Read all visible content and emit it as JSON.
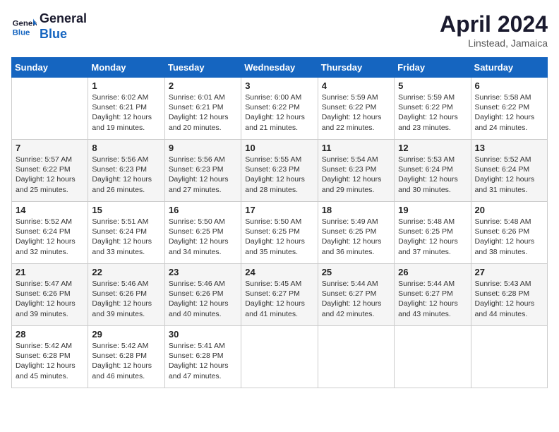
{
  "header": {
    "logo_line1": "General",
    "logo_line2": "Blue",
    "month_title": "April 2024",
    "location": "Linstead, Jamaica"
  },
  "weekdays": [
    "Sunday",
    "Monday",
    "Tuesday",
    "Wednesday",
    "Thursday",
    "Friday",
    "Saturday"
  ],
  "rows": [
    [
      {
        "day": "",
        "sunrise": "",
        "sunset": "",
        "daylight": ""
      },
      {
        "day": "1",
        "sunrise": "Sunrise: 6:02 AM",
        "sunset": "Sunset: 6:21 PM",
        "daylight": "Daylight: 12 hours and 19 minutes."
      },
      {
        "day": "2",
        "sunrise": "Sunrise: 6:01 AM",
        "sunset": "Sunset: 6:21 PM",
        "daylight": "Daylight: 12 hours and 20 minutes."
      },
      {
        "day": "3",
        "sunrise": "Sunrise: 6:00 AM",
        "sunset": "Sunset: 6:22 PM",
        "daylight": "Daylight: 12 hours and 21 minutes."
      },
      {
        "day": "4",
        "sunrise": "Sunrise: 5:59 AM",
        "sunset": "Sunset: 6:22 PM",
        "daylight": "Daylight: 12 hours and 22 minutes."
      },
      {
        "day": "5",
        "sunrise": "Sunrise: 5:59 AM",
        "sunset": "Sunset: 6:22 PM",
        "daylight": "Daylight: 12 hours and 23 minutes."
      },
      {
        "day": "6",
        "sunrise": "Sunrise: 5:58 AM",
        "sunset": "Sunset: 6:22 PM",
        "daylight": "Daylight: 12 hours and 24 minutes."
      }
    ],
    [
      {
        "day": "7",
        "sunrise": "Sunrise: 5:57 AM",
        "sunset": "Sunset: 6:22 PM",
        "daylight": "Daylight: 12 hours and 25 minutes."
      },
      {
        "day": "8",
        "sunrise": "Sunrise: 5:56 AM",
        "sunset": "Sunset: 6:23 PM",
        "daylight": "Daylight: 12 hours and 26 minutes."
      },
      {
        "day": "9",
        "sunrise": "Sunrise: 5:56 AM",
        "sunset": "Sunset: 6:23 PM",
        "daylight": "Daylight: 12 hours and 27 minutes."
      },
      {
        "day": "10",
        "sunrise": "Sunrise: 5:55 AM",
        "sunset": "Sunset: 6:23 PM",
        "daylight": "Daylight: 12 hours and 28 minutes."
      },
      {
        "day": "11",
        "sunrise": "Sunrise: 5:54 AM",
        "sunset": "Sunset: 6:23 PM",
        "daylight": "Daylight: 12 hours and 29 minutes."
      },
      {
        "day": "12",
        "sunrise": "Sunrise: 5:53 AM",
        "sunset": "Sunset: 6:24 PM",
        "daylight": "Daylight: 12 hours and 30 minutes."
      },
      {
        "day": "13",
        "sunrise": "Sunrise: 5:52 AM",
        "sunset": "Sunset: 6:24 PM",
        "daylight": "Daylight: 12 hours and 31 minutes."
      }
    ],
    [
      {
        "day": "14",
        "sunrise": "Sunrise: 5:52 AM",
        "sunset": "Sunset: 6:24 PM",
        "daylight": "Daylight: 12 hours and 32 minutes."
      },
      {
        "day": "15",
        "sunrise": "Sunrise: 5:51 AM",
        "sunset": "Sunset: 6:24 PM",
        "daylight": "Daylight: 12 hours and 33 minutes."
      },
      {
        "day": "16",
        "sunrise": "Sunrise: 5:50 AM",
        "sunset": "Sunset: 6:25 PM",
        "daylight": "Daylight: 12 hours and 34 minutes."
      },
      {
        "day": "17",
        "sunrise": "Sunrise: 5:50 AM",
        "sunset": "Sunset: 6:25 PM",
        "daylight": "Daylight: 12 hours and 35 minutes."
      },
      {
        "day": "18",
        "sunrise": "Sunrise: 5:49 AM",
        "sunset": "Sunset: 6:25 PM",
        "daylight": "Daylight: 12 hours and 36 minutes."
      },
      {
        "day": "19",
        "sunrise": "Sunrise: 5:48 AM",
        "sunset": "Sunset: 6:25 PM",
        "daylight": "Daylight: 12 hours and 37 minutes."
      },
      {
        "day": "20",
        "sunrise": "Sunrise: 5:48 AM",
        "sunset": "Sunset: 6:26 PM",
        "daylight": "Daylight: 12 hours and 38 minutes."
      }
    ],
    [
      {
        "day": "21",
        "sunrise": "Sunrise: 5:47 AM",
        "sunset": "Sunset: 6:26 PM",
        "daylight": "Daylight: 12 hours and 39 minutes."
      },
      {
        "day": "22",
        "sunrise": "Sunrise: 5:46 AM",
        "sunset": "Sunset: 6:26 PM",
        "daylight": "Daylight: 12 hours and 39 minutes."
      },
      {
        "day": "23",
        "sunrise": "Sunrise: 5:46 AM",
        "sunset": "Sunset: 6:26 PM",
        "daylight": "Daylight: 12 hours and 40 minutes."
      },
      {
        "day": "24",
        "sunrise": "Sunrise: 5:45 AM",
        "sunset": "Sunset: 6:27 PM",
        "daylight": "Daylight: 12 hours and 41 minutes."
      },
      {
        "day": "25",
        "sunrise": "Sunrise: 5:44 AM",
        "sunset": "Sunset: 6:27 PM",
        "daylight": "Daylight: 12 hours and 42 minutes."
      },
      {
        "day": "26",
        "sunrise": "Sunrise: 5:44 AM",
        "sunset": "Sunset: 6:27 PM",
        "daylight": "Daylight: 12 hours and 43 minutes."
      },
      {
        "day": "27",
        "sunrise": "Sunrise: 5:43 AM",
        "sunset": "Sunset: 6:28 PM",
        "daylight": "Daylight: 12 hours and 44 minutes."
      }
    ],
    [
      {
        "day": "28",
        "sunrise": "Sunrise: 5:42 AM",
        "sunset": "Sunset: 6:28 PM",
        "daylight": "Daylight: 12 hours and 45 minutes."
      },
      {
        "day": "29",
        "sunrise": "Sunrise: 5:42 AM",
        "sunset": "Sunset: 6:28 PM",
        "daylight": "Daylight: 12 hours and 46 minutes."
      },
      {
        "day": "30",
        "sunrise": "Sunrise: 5:41 AM",
        "sunset": "Sunset: 6:28 PM",
        "daylight": "Daylight: 12 hours and 47 minutes."
      },
      {
        "day": "",
        "sunrise": "",
        "sunset": "",
        "daylight": ""
      },
      {
        "day": "",
        "sunrise": "",
        "sunset": "",
        "daylight": ""
      },
      {
        "day": "",
        "sunrise": "",
        "sunset": "",
        "daylight": ""
      },
      {
        "day": "",
        "sunrise": "",
        "sunset": "",
        "daylight": ""
      }
    ]
  ]
}
